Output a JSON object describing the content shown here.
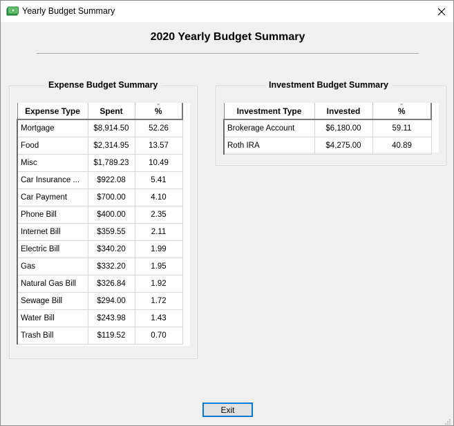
{
  "window": {
    "title": "Yearly Budget Summary",
    "app_icon": "money-icon",
    "close_icon": "close-icon"
  },
  "header": {
    "title": "2020 Yearly Budget Summary"
  },
  "expense": {
    "group_title": "Expense Budget Summary",
    "columns": [
      "Expense Type",
      "Spent",
      "%"
    ],
    "rows": [
      {
        "type": "Mortgage",
        "spent": "$8,914.50",
        "pct": "52.26"
      },
      {
        "type": "Food",
        "spent": "$2,314.95",
        "pct": "13.57"
      },
      {
        "type": "Misc",
        "spent": "$1,789.23",
        "pct": "10.49"
      },
      {
        "type": "Car Insurance ...",
        "spent": "$922.08",
        "pct": "5.41"
      },
      {
        "type": "Car Payment",
        "spent": "$700.00",
        "pct": "4.10"
      },
      {
        "type": "Phone Bill",
        "spent": "$400.00",
        "pct": "2.35"
      },
      {
        "type": "Internet Bill",
        "spent": "$359.55",
        "pct": "2.11"
      },
      {
        "type": "Electric Bill",
        "spent": "$340.20",
        "pct": "1.99"
      },
      {
        "type": "Gas",
        "spent": "$332.20",
        "pct": "1.95"
      },
      {
        "type": "Natural Gas Bill",
        "spent": "$326.84",
        "pct": "1.92"
      },
      {
        "type": "Sewage Bill",
        "spent": "$294.00",
        "pct": "1.72"
      },
      {
        "type": "Water Bill",
        "spent": "$243.98",
        "pct": "1.43"
      },
      {
        "type": "Trash Bill",
        "spent": "$119.52",
        "pct": "0.70"
      }
    ]
  },
  "investment": {
    "group_title": "Investment Budget Summary",
    "columns": [
      "Investment Type",
      "Invested",
      "%"
    ],
    "rows": [
      {
        "type": "Brokerage Account",
        "invested": "$6,180.00",
        "pct": "59.11"
      },
      {
        "type": "Roth IRA",
        "invested": "$4,275.00",
        "pct": "40.89"
      }
    ]
  },
  "footer": {
    "exit_label": "Exit"
  },
  "colors": {
    "accent": "#0078d7",
    "icon_green": "#4caf50"
  }
}
